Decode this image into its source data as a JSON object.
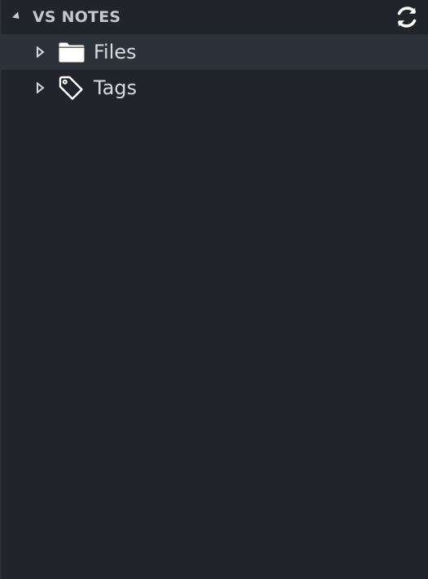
{
  "section": {
    "title": "VS NOTES",
    "collapse_icon": "chevron-down-icon",
    "refresh_icon": "refresh-icon"
  },
  "tree": {
    "items": [
      {
        "label": "Files",
        "icon": "folder-icon",
        "expanded": false,
        "selected": true
      },
      {
        "label": "Tags",
        "icon": "tag-icon",
        "expanded": false,
        "selected": false
      }
    ]
  },
  "colors": {
    "background": "#21252b",
    "selected_row": "#2c313a",
    "text": "#d7dae0",
    "header_text": "#c4c7cd"
  }
}
